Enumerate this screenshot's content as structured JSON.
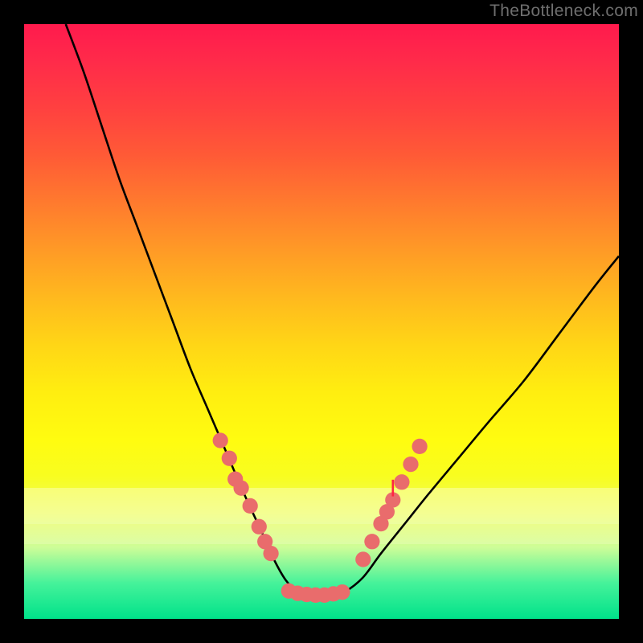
{
  "watermark": "TheBottleneck.com",
  "chart_data": {
    "type": "line",
    "title": "",
    "xlabel": "",
    "ylabel": "",
    "xlim": [
      0,
      100
    ],
    "ylim": [
      0,
      100
    ],
    "grid": false,
    "legend": false,
    "series": [
      {
        "name": "bottleneck-curve",
        "color": "#000000",
        "x": [
          7,
          10,
          13,
          16,
          19,
          22,
          25,
          28,
          31,
          34,
          37,
          40,
          42,
          44,
          46,
          48,
          50,
          52,
          54,
          57,
          60,
          64,
          68,
          73,
          78,
          84,
          90,
          96,
          100
        ],
        "y": [
          100,
          92,
          83,
          74,
          66,
          58,
          50,
          42,
          35,
          28,
          21,
          14.5,
          10,
          6.5,
          4.5,
          4,
          4,
          4,
          4.6,
          7,
          11,
          16,
          21,
          27,
          33,
          40,
          48,
          56,
          61
        ]
      }
    ],
    "markers": {
      "name": "clustered-points",
      "color": "#e96c6c",
      "radius": 1.3,
      "points": [
        {
          "x": 33,
          "y": 30
        },
        {
          "x": 34.5,
          "y": 27
        },
        {
          "x": 35.5,
          "y": 23.5
        },
        {
          "x": 36.5,
          "y": 22
        },
        {
          "x": 38,
          "y": 19
        },
        {
          "x": 39.5,
          "y": 15.5
        },
        {
          "x": 40.5,
          "y": 13
        },
        {
          "x": 41.5,
          "y": 11
        },
        {
          "x": 44.5,
          "y": 4.7
        },
        {
          "x": 46,
          "y": 4.3
        },
        {
          "x": 47.5,
          "y": 4.1
        },
        {
          "x": 49,
          "y": 4.0
        },
        {
          "x": 50.5,
          "y": 4.0
        },
        {
          "x": 52,
          "y": 4.2
        },
        {
          "x": 53.5,
          "y": 4.5
        },
        {
          "x": 57,
          "y": 10
        },
        {
          "x": 58.5,
          "y": 13
        },
        {
          "x": 60,
          "y": 16
        },
        {
          "x": 61,
          "y": 18
        },
        {
          "x": 62,
          "y": 20
        },
        {
          "x": 63.5,
          "y": 23
        },
        {
          "x": 65,
          "y": 26
        },
        {
          "x": 66.5,
          "y": 29
        }
      ]
    },
    "tick_mark": {
      "x": 62,
      "y": 22,
      "len": 1.4,
      "color": "#ff2540"
    }
  }
}
